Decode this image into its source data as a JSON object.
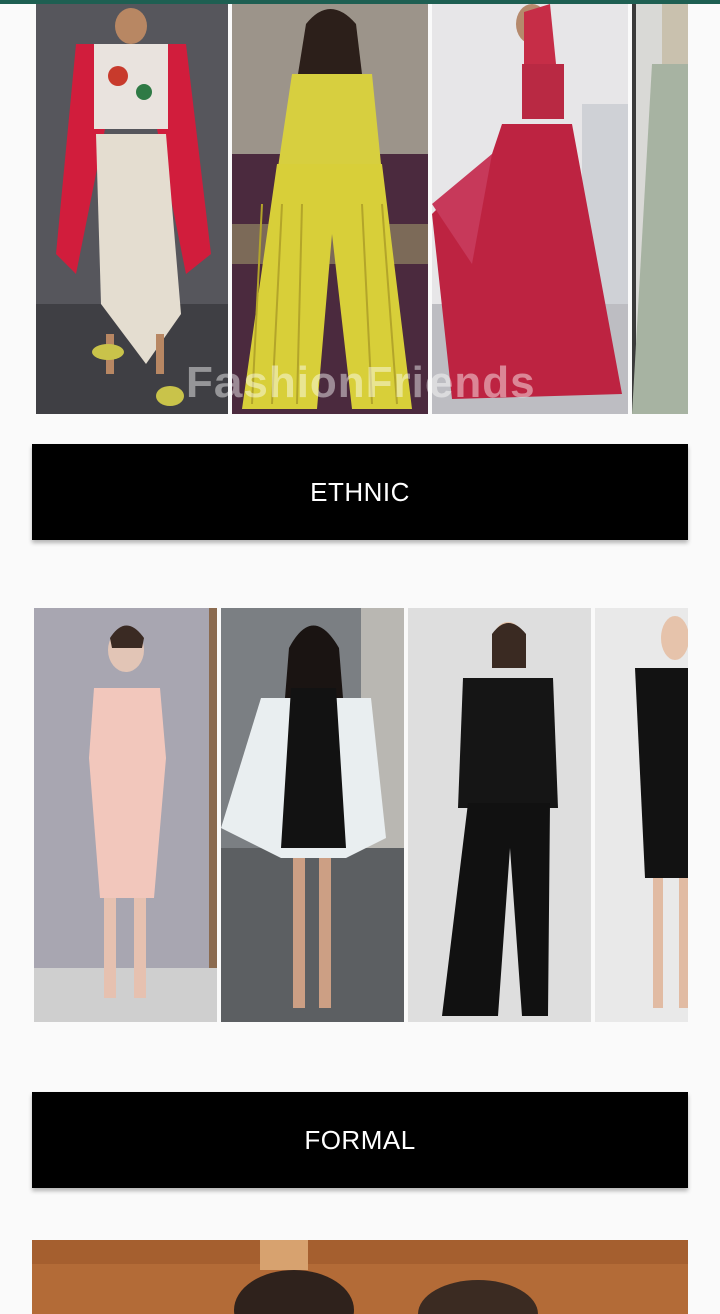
{
  "categories": [
    {
      "id": "ethnic",
      "label": "ETHNIC"
    },
    {
      "id": "formal",
      "label": "FORMAL"
    }
  ],
  "watermark": "FashionFriends",
  "colors": {
    "accent": "#1e5f52",
    "button_bg": "#000000",
    "button_text": "#ffffff",
    "background": "#fafafa"
  }
}
